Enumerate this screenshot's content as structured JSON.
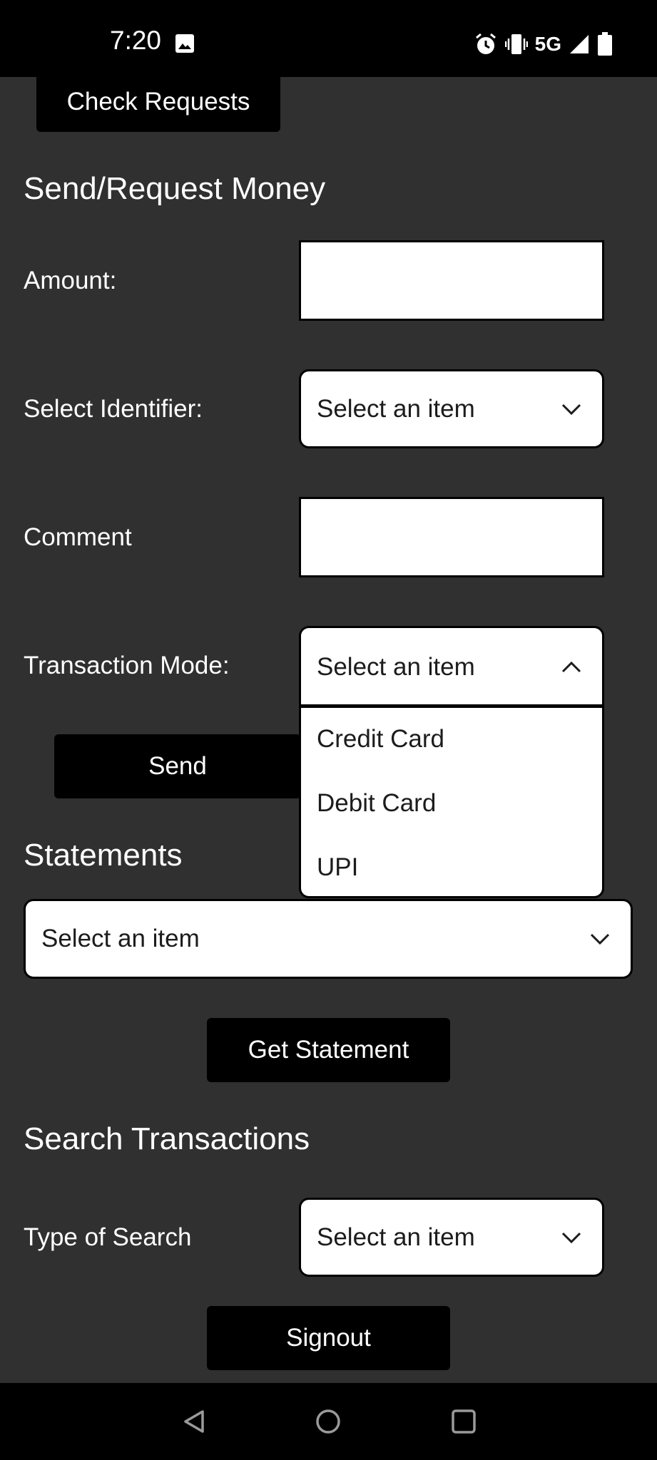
{
  "status_bar": {
    "time": "7:20",
    "network": "5G"
  },
  "buttons": {
    "check_requests": "Check Requests",
    "send": "Send",
    "get_statement": "Get Statement",
    "signout": "Signout"
  },
  "send_request": {
    "title": "Send/Request Money",
    "amount_label": "Amount:",
    "identifier_label": "Select Identifier:",
    "identifier_value": "Select an item",
    "comment_label": "Comment",
    "mode_label": "Transaction Mode:",
    "mode_value": "Select an item",
    "mode_options": [
      "Credit Card",
      "Debit Card",
      "UPI"
    ]
  },
  "statements": {
    "title": "Statements",
    "select_value": "Select an item"
  },
  "search": {
    "title": "Search Transactions",
    "type_label": "Type of Search",
    "type_value": "Select an item"
  }
}
